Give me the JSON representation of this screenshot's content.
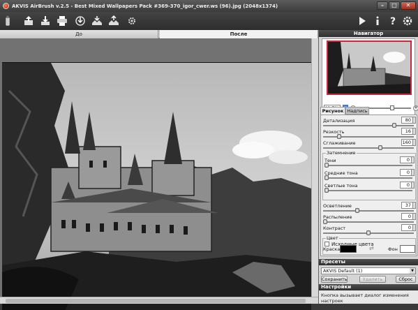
{
  "window": {
    "title": "AKVIS AirBrush v.2.5 - Best Mixed Wallpapers Pack #369-370_igor_cwer.ws (96).jpg (2048x1374)",
    "minimize": "–",
    "maximize": "□",
    "close": "✕"
  },
  "toolbar": {
    "left_icons": [
      "open-icon",
      "save-icon",
      "print-icon",
      "share-icon",
      "import-presets-icon",
      "export-presets-icon",
      "preferences-icon"
    ],
    "right_icons": [
      "run-icon",
      "info-icon",
      "help-icon",
      "settings-gear-icon"
    ]
  },
  "view_tabs": {
    "before": "До",
    "after": "После"
  },
  "navigator": {
    "title": "Навигатор",
    "zoom": "40.7%",
    "zoom_minus": "–",
    "zoom_plus": "+"
  },
  "param_tabs": {
    "drawing": "Рисунок",
    "caption": "Надпись"
  },
  "params": {
    "detail": {
      "label": "Детализация",
      "value": "80",
      "level": 0.8
    },
    "sharpness": {
      "label": "Резкость",
      "value": "16",
      "level": 0.16
    },
    "smoothing": {
      "label": "Сглаживание",
      "value": "160",
      "level": 0.64
    },
    "shading_group": "Затемнение",
    "shadows": {
      "label": "Тени",
      "value": "0",
      "level": 0
    },
    "midtones": {
      "label": "Средние тона",
      "value": "0",
      "level": 0
    },
    "highlights": {
      "label": "Светлые тона",
      "value": "0",
      "level": 0
    },
    "lightening": {
      "label": "Осветление",
      "value": "37",
      "level": 0.37
    },
    "spray": {
      "label": "Распыление",
      "value": "0",
      "level": 0
    },
    "contrast": {
      "label": "Контраст",
      "value": "0",
      "level": 0.5
    },
    "color_group": "Цвет",
    "source_colors": "Исходные цвета",
    "paint_label": "Краска",
    "background_label": "Фон",
    "paint_color": "#000000",
    "background_color": "#ffffff"
  },
  "presets": {
    "title": "Пресеты",
    "selected": "AKVIS Default (1)",
    "save": "Сохранить",
    "delete": "Удалить",
    "reset": "Сброс"
  },
  "settings": {
    "title": "Настройки",
    "text": "Кнопка вызывает диалог изменения настроек"
  }
}
